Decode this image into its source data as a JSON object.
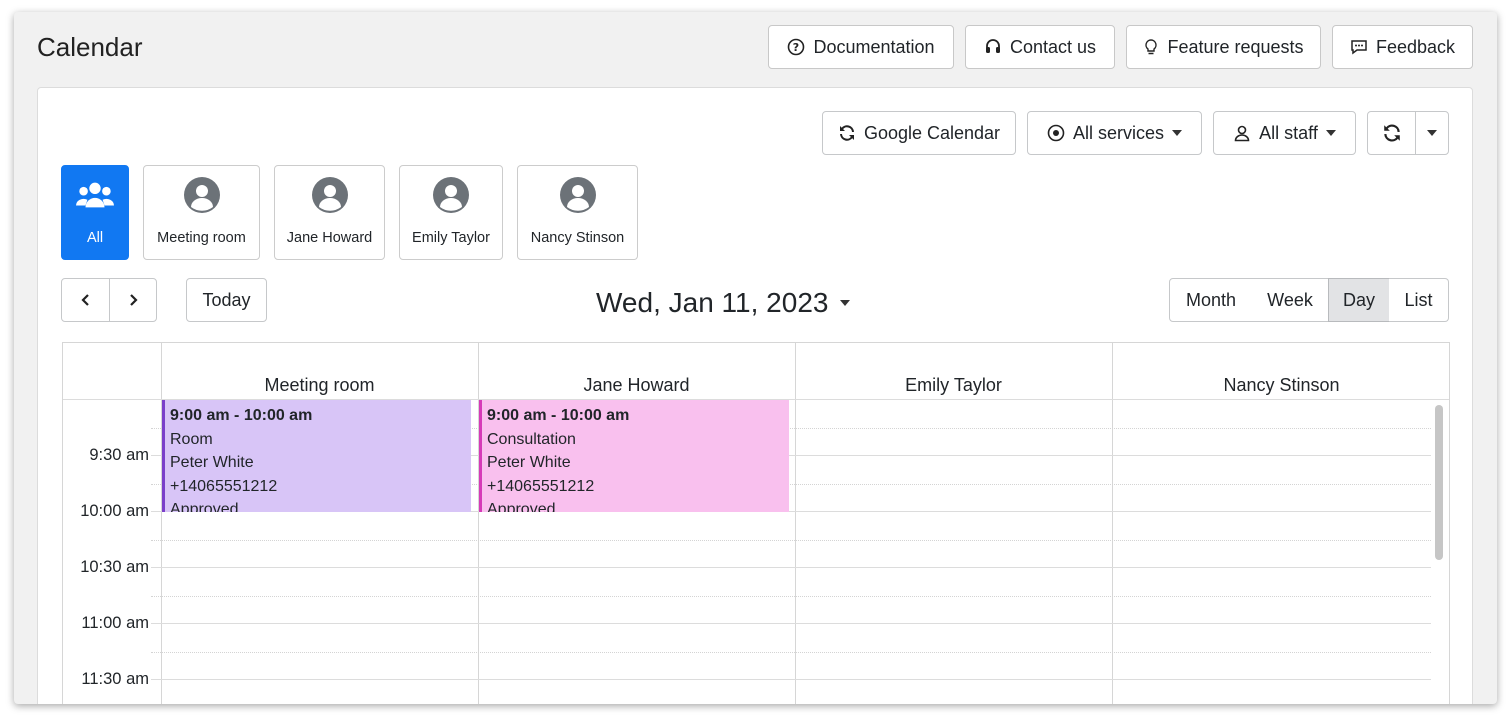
{
  "page": {
    "title": "Calendar"
  },
  "header": {
    "buttons": [
      {
        "label": "Documentation",
        "icon": "question-circle-icon"
      },
      {
        "label": "Contact us",
        "icon": "headset-icon"
      },
      {
        "label": "Feature requests",
        "icon": "lightbulb-icon"
      },
      {
        "label": "Feedback",
        "icon": "chat-icon"
      }
    ]
  },
  "toolbar": {
    "google_calendar": "Google Calendar",
    "services": "All services",
    "staff": "All staff"
  },
  "staff_filter": [
    {
      "label": "All",
      "active": true
    },
    {
      "label": "Meeting room",
      "active": false
    },
    {
      "label": "Jane Howard",
      "active": false
    },
    {
      "label": "Emily Taylor",
      "active": false
    },
    {
      "label": "Nancy Stinson",
      "active": false
    }
  ],
  "nav": {
    "today": "Today",
    "date": "Wed, Jan 11, 2023"
  },
  "views": [
    {
      "label": "Month",
      "active": false
    },
    {
      "label": "Week",
      "active": false
    },
    {
      "label": "Day",
      "active": true
    },
    {
      "label": "List",
      "active": false
    }
  ],
  "calendar": {
    "columns": [
      "Meeting room",
      "Jane Howard",
      "Emily Taylor",
      "Nancy Stinson"
    ],
    "times": [
      "9:30 am",
      "10:00 am",
      "10:30 am",
      "11:00 am",
      "11:30 am"
    ],
    "events": [
      {
        "column": "Meeting room",
        "time": "9:00 am - 10:00 am",
        "service": "Room",
        "customer": "Peter White",
        "phone": "+14065551212",
        "status": "Approved",
        "color": "#d8c5f7",
        "border": "#7a3fc9"
      },
      {
        "column": "Jane Howard",
        "time": "9:00 am - 10:00 am",
        "service": "Consultation",
        "customer": "Peter White",
        "phone": "+14065551212",
        "status": "Approved",
        "color": "#f9c0ee",
        "border": "#d63ab8"
      }
    ]
  },
  "colors": {
    "primary": "#1178f2",
    "active_view": "#e2e3e5"
  }
}
